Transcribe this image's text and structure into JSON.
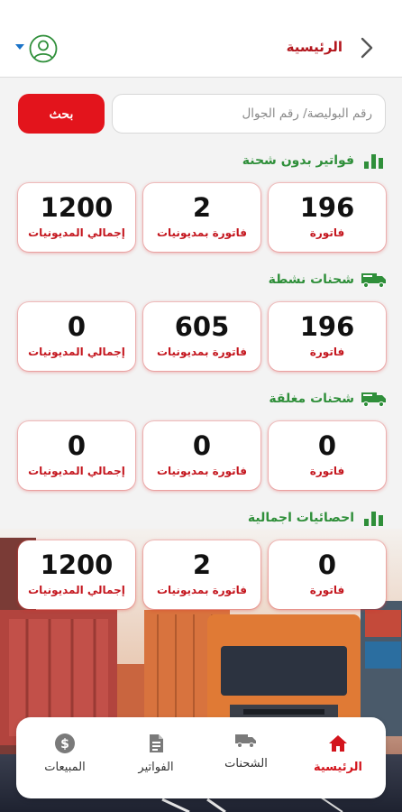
{
  "header": {
    "title": "الرئيسية"
  },
  "search": {
    "placeholder": "رقم البوليصة/ رقم الجوال",
    "button_label": "بحث"
  },
  "sections": [
    {
      "title": "فواتير بدون شحنة",
      "icon": "bar-chart-icon",
      "cards": [
        {
          "value": "196",
          "label": "فاتورة"
        },
        {
          "value": "2",
          "label": "فاتورة بمديونيات"
        },
        {
          "value": "1200",
          "label": "إجمالي المديونيات"
        }
      ]
    },
    {
      "title": "شحنات نشطة",
      "icon": "truck-icon",
      "cards": [
        {
          "value": "196",
          "label": "فاتورة"
        },
        {
          "value": "605",
          "label": "فاتورة بمديونيات"
        },
        {
          "value": "0",
          "label": "إجمالي المديونيات"
        }
      ]
    },
    {
      "title": "شحنات مغلقة",
      "icon": "truck-icon",
      "cards": [
        {
          "value": "0",
          "label": "فاتورة"
        },
        {
          "value": "0",
          "label": "فاتورة بمديونيات"
        },
        {
          "value": "0",
          "label": "إجمالي المديونيات"
        }
      ]
    },
    {
      "title": "احصائيات اجمالية",
      "icon": "bar-chart-icon",
      "cards": [
        {
          "value": "0",
          "label": "فاتورة"
        },
        {
          "value": "2",
          "label": "فاتورة بمديونيات"
        },
        {
          "value": "1200",
          "label": "إجمالي المديونيات"
        }
      ]
    }
  ],
  "nav": [
    {
      "label": "الرئيسية",
      "icon": "home-icon",
      "active": true
    },
    {
      "label": "الشحنات",
      "icon": "truck-icon",
      "active": false
    },
    {
      "label": "الفواتير",
      "icon": "invoice-icon",
      "active": false
    },
    {
      "label": "المبيعات",
      "icon": "dollar-icon",
      "active": false
    }
  ],
  "colors": {
    "accent": "#e3141c",
    "title_red": "#b3171e",
    "section_green": "#2f8f3a",
    "nav_blue": "#1a73c8"
  }
}
